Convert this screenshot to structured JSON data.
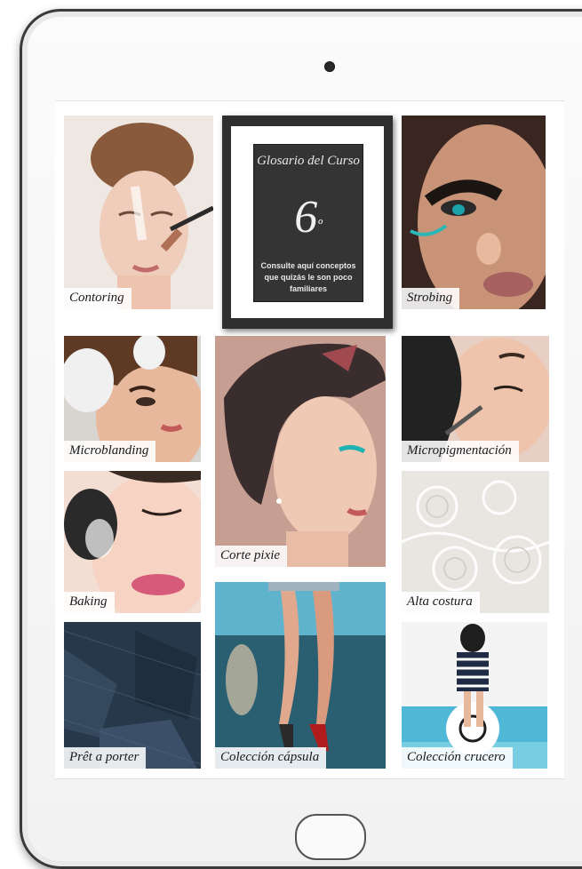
{
  "glossary": {
    "title": "Glosario del Curso",
    "number": "6",
    "ordinal": "º",
    "description": "Consulte aquí conceptos que quizás le son poco familiares"
  },
  "tiles": [
    {
      "label": "Contoring",
      "icon": "makeup-contour-photo"
    },
    {
      "label": "Strobing",
      "icon": "makeup-strobing-photo"
    },
    {
      "label": "Microblanding",
      "icon": "eyebrow-treatment-photo"
    },
    {
      "label": "Corte pixie",
      "icon": "pixie-haircut-photo"
    },
    {
      "label": "Micropigmentación",
      "icon": "micropigmentation-photo"
    },
    {
      "label": "Baking",
      "icon": "baking-makeup-photo"
    },
    {
      "label": "Alta costura",
      "icon": "lace-fabric-photo"
    },
    {
      "label": "Prêt a porter",
      "icon": "denim-fabric-photo"
    },
    {
      "label": "Colección cápsula",
      "icon": "runway-legs-photo"
    },
    {
      "label": "Colección crucero",
      "icon": "beach-fashion-photo"
    }
  ]
}
